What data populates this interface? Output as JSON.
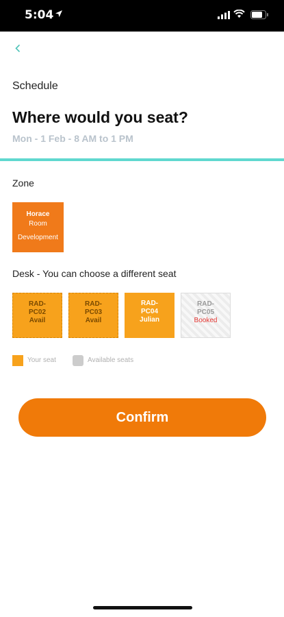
{
  "status_bar": {
    "time": "5:04"
  },
  "header": {
    "section": "Schedule",
    "title": "Where would you seat?",
    "subtitle": "Mon - 1 Feb - 8 AM to 1 PM"
  },
  "zone": {
    "label": "Zone",
    "tile": {
      "line1": "Horace",
      "line2": "Room",
      "line3": "Development"
    }
  },
  "desk_section": {
    "label": "Desk - You can choose a different seat",
    "desks": [
      {
        "line1": "RAD-",
        "line2": "PC02",
        "status": "Avail",
        "state": "available"
      },
      {
        "line1": "RAD-",
        "line2": "PC03",
        "status": "Avail",
        "state": "available"
      },
      {
        "line1": "RAD-",
        "line2": "PC04",
        "status": "Julian",
        "state": "yours"
      },
      {
        "line1": "RAD-",
        "line2": "PC05",
        "status": "Booked",
        "state": "booked"
      }
    ]
  },
  "legend": {
    "your_seat": "Your seat",
    "available_seats": "Available seats"
  },
  "confirm_label": "Confirm",
  "colors": {
    "accent": "#f07a09",
    "seat": "#f7a21c",
    "divider": "#5fd8cf",
    "booked_text": "#e53935"
  }
}
